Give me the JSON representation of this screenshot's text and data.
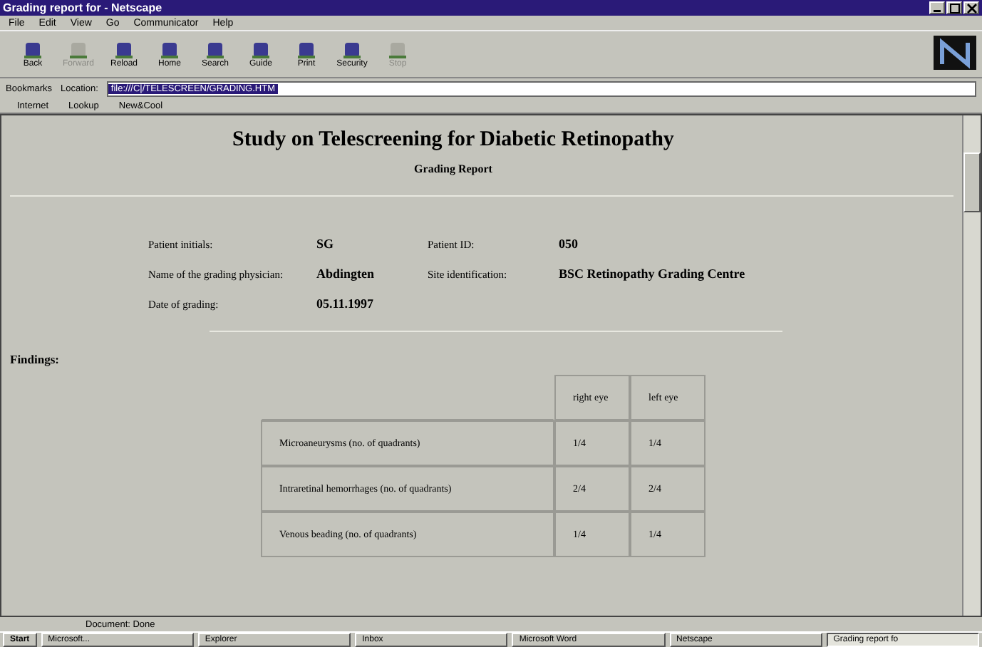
{
  "window": {
    "title": "Grading report for - Netscape"
  },
  "menu": [
    "File",
    "Edit",
    "View",
    "Go",
    "Communicator",
    "Help"
  ],
  "toolbar": [
    {
      "label": "Back",
      "disabled": false
    },
    {
      "label": "Forward",
      "disabled": true
    },
    {
      "label": "Reload",
      "disabled": false
    },
    {
      "label": "Home",
      "disabled": false
    },
    {
      "label": "Search",
      "disabled": false
    },
    {
      "label": "Guide",
      "disabled": false
    },
    {
      "label": "Print",
      "disabled": false
    },
    {
      "label": "Security",
      "disabled": false
    },
    {
      "label": "Stop",
      "disabled": true
    }
  ],
  "location": {
    "bookmarks": "Bookmarks",
    "label": "Location:",
    "value": "file:///C|/TELESCREEN/GRADING.HTM"
  },
  "personal_toolbar": [
    "Internet",
    "Lookup",
    "New&Cool"
  ],
  "page": {
    "title": "Study on Telescreening for Diabetic Retinopathy",
    "subtitle": "Grading Report",
    "fields": [
      {
        "label": "Patient initials:",
        "value": "SG",
        "label_2": "Patient ID:",
        "value_2": "050"
      },
      {
        "label": "Name of the grading physician:",
        "value": "Abdingten",
        "label_2": "Site identification:",
        "value_2": "BSC Retinopathy Grading Centre"
      },
      {
        "label": "Date of grading:",
        "value": "05.11.1997"
      }
    ],
    "findings": "Findings:",
    "table": {
      "columns": [
        "right eye",
        "left eye"
      ],
      "rows": [
        {
          "label": "Microaneurysms (no. of quadrants)",
          "right": "1/4",
          "left": "1/4"
        },
        {
          "label": "Intraretinal hemorrhages (no. of quadrants)",
          "right": "2/4",
          "left": "2/4"
        },
        {
          "label": "Venous beading (no. of quadrants)",
          "right": "1/4",
          "left": "1/4"
        }
      ]
    }
  },
  "status_bar": "Document: Done",
  "taskbar": [
    {
      "label": "Start",
      "selected": false
    },
    {
      "label": "Microsoft...",
      "selected": false
    },
    {
      "label": "Explorer",
      "selected": false
    },
    {
      "label": "Inbox",
      "selected": false
    },
    {
      "label": "Microsoft Word",
      "selected": false
    },
    {
      "label": "Netscape",
      "selected": false
    },
    {
      "label": "Grading report fo",
      "selected": true
    }
  ]
}
